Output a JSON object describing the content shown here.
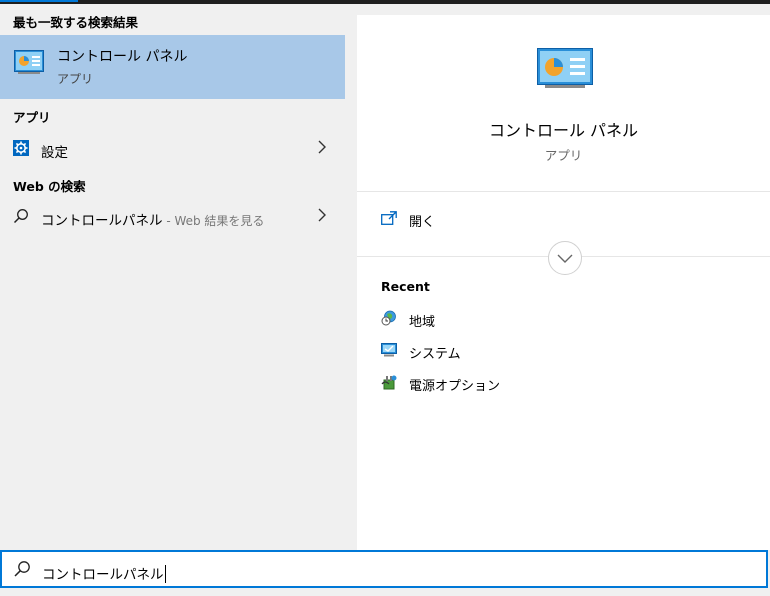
{
  "colors": {
    "accent": "#0078d7",
    "selected_bg": "#a8c8e8"
  },
  "left": {
    "best_match_heading": "最も一致する検索結果",
    "best_match": {
      "title": "コントロール パネル",
      "subtitle": "アプリ",
      "icon": "control-panel-icon"
    },
    "apps_heading": "アプリ",
    "apps": [
      {
        "label": "設定",
        "icon": "gear-icon"
      }
    ],
    "web_heading": "Web の検索",
    "web": {
      "query": "コントロールパネル",
      "hint": " - Web 結果を見る",
      "icon": "search-icon"
    }
  },
  "right": {
    "title": "コントロール パネル",
    "subtitle": "アプリ",
    "open_label": "開く",
    "recent_heading": "Recent",
    "recent": [
      {
        "label": "地域",
        "icon": "globe-clock-icon"
      },
      {
        "label": "システム",
        "icon": "monitor-icon"
      },
      {
        "label": "電源オプション",
        "icon": "power-options-icon"
      }
    ]
  },
  "search": {
    "value": "コントロールパネル"
  }
}
